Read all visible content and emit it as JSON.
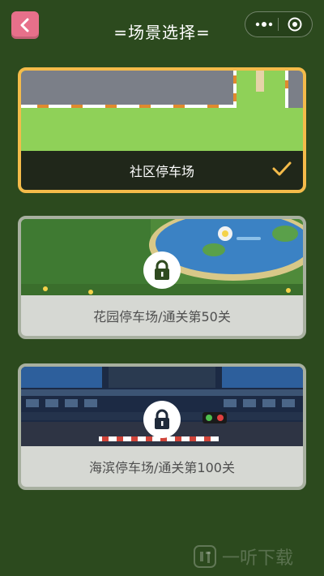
{
  "header": {
    "title": "=场景选择=",
    "back_icon": "chevron-left-icon",
    "menu_icon": "more-dots-icon",
    "close_icon": "circle-close-icon"
  },
  "scenes": [
    {
      "label": "社区停车场",
      "status": "selected",
      "icon": "checkmark-icon"
    },
    {
      "label": "花园停车场/通关第50关",
      "status": "locked",
      "icon": "lock-icon"
    },
    {
      "label": "海滨停车场/通关第100关",
      "status": "locked",
      "icon": "lock-icon"
    }
  ],
  "watermark": {
    "text": "一听下载"
  },
  "colors": {
    "background": "#2c4a1e",
    "back_button": "#e7708a",
    "selected_border": "#f4bb4a",
    "locked_border": "#a8b0a0"
  }
}
